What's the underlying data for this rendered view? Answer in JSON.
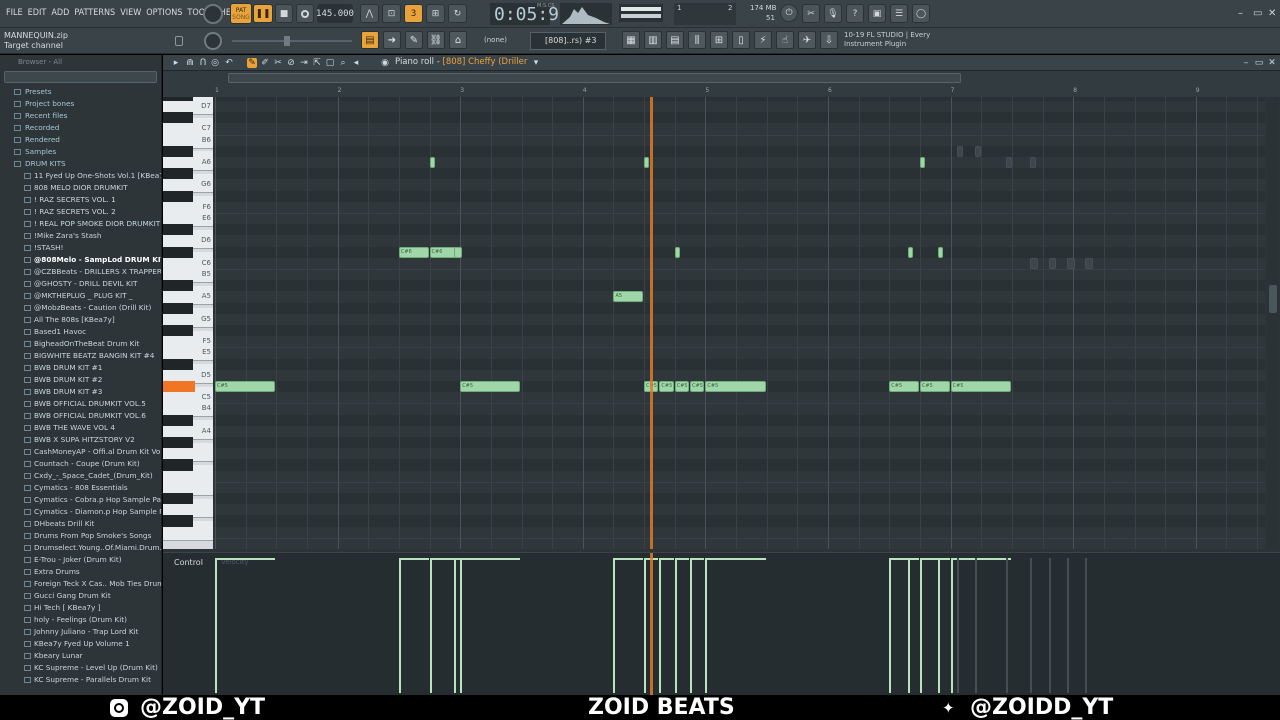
{
  "menu": [
    "FILE",
    "EDIT",
    "ADD",
    "PATTERNS",
    "VIEW",
    "OPTIONS",
    "TOOLS",
    "HELP"
  ],
  "transport": {
    "pat_label": "PAT",
    "song_label": "SONG",
    "tempo": "145.000",
    "time": "0:05:92",
    "time_unit": "M:S:CS",
    "memory": "174 MB",
    "memory_sub": "51",
    "cpu_top": "1",
    "cpu_num": "2"
  },
  "hint": {
    "line1": "MANNEQUIN.zip",
    "line2": "Target channel"
  },
  "toolbar2": {
    "pattern_none": "(none)",
    "pattern_select": "[808]..rs) #3",
    "news_line1": "10-19  FL STUDIO | Every",
    "news_line2": "Instrument Plugin"
  },
  "browser": {
    "header": "Browser - All",
    "top_items": [
      "Presets",
      "Project bones",
      "Recent files",
      "Recorded",
      "Rendered",
      "Samples",
      "DRUM KITS"
    ],
    "samples": [
      "11 Fyed Up One-Shots Vol.1 [KBea7y]",
      "808 MELO DIOR DRUMKIT",
      "! RAZ SECRETS VOL. 1",
      "! RAZ SECRETS VOL. 2",
      "! REAL POP SMOKE DIOR DRUMKIT",
      "!Mike Zara's Stash",
      "!STASH!",
      "@808Melo - SampLod DRUM KIT 2018",
      "@CZBBeats - DRILLERS X TRAPPERS KIT",
      "@GHOSTY - DRILL DEVIL KIT",
      "@MKTHEPLUG _ PLUG KIT _",
      "@MobzBeats - Caution (Drill Kit)",
      "All The 808s [KBea7y]",
      "Based1 Havoc",
      "BigheadOnTheBeat Drum Kit",
      "BIGWHITE BEATZ BANGIN KIT #4",
      "BWB DRUM KIT #1",
      "BWB DRUM KIT #2",
      "BWB DRUM KIT #3",
      "BWB OFFICIAL DRUMKIT VOL.5",
      "BWB OFFICIAL DRUMKIT VOL.6",
      "BWB THE WAVE VOL 4",
      "BWB X SUPA HITZSTORY V2",
      "CashMoneyAP - Offi.al Drum Kit Vol. 1",
      "Countach - Coupe (Drum Kit)",
      "Cxdy_-_Space_Cadet_(Drum_Kit)",
      "Cymatics - 808 Essentials",
      "Cymatics - Cobra.p Hop Sample Pack",
      "Cymatics - Diamon.p Hop Sample Pack",
      "DHbeats Drill Kit",
      "Drums From Pop Smoke's Songs",
      "Drumselect.Young..Of.Miami.Drum.Kit",
      "E-Trou - Joker (Drum Kit)",
      "Extra Drums",
      "Foreign Teck X Cas.. Mob Ties Drumkit",
      "Gucci Gang Drum Kit",
      "Hi Tech [ KBea7y ]",
      "holy - Feelings (Drum Kit)",
      "Johnny Juliano - Trap Lord Kit",
      "KBea7y Fyed Up Volume 1",
      "Kbeary Lunar",
      "KC Supreme - Level Up (Drum Kit)",
      "KC Supreme - Parallels Drum Kit"
    ]
  },
  "piano_roll": {
    "title_prefix": "Piano roll - ",
    "title_channel": "[808] Cheffy (Driller",
    "bar_numbers": [
      "1",
      "2",
      "3",
      "4",
      "5",
      "6",
      "7",
      "8",
      "9"
    ],
    "key_labels": [
      "D7",
      "C7",
      "B6",
      "A6",
      "G6",
      "F6",
      "E6",
      "D6",
      "C6",
      "B5",
      "A5",
      "G5",
      "F5",
      "E5",
      "D5",
      "C5",
      "B4",
      "A4"
    ],
    "control_label": "Control",
    "control_param": "Velocity",
    "note_labels": {
      "c5": "C#5",
      "c6": "C#6",
      "a5": "A5"
    }
  },
  "footer": {
    "instagram": "@ZOID_YT",
    "center": "ZOID BEATS",
    "twitter": "@ZOIDD_YT"
  },
  "colors": {
    "note": "#9fd7a8",
    "playhead": "#e07a24",
    "accent": "#f0a33a"
  }
}
